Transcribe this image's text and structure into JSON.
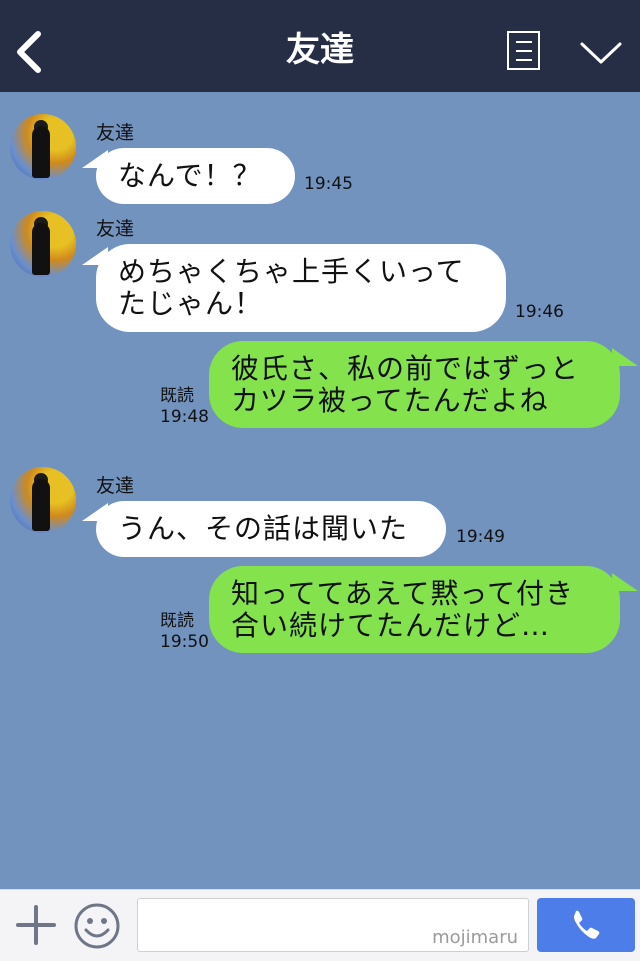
{
  "header": {
    "title": "友達",
    "icons": [
      "back-chevron-icon",
      "menu-list-icon",
      "chevron-down-icon"
    ]
  },
  "messages": [
    {
      "side": "in",
      "name": "友達",
      "text": "なんで！？",
      "time": "19:45"
    },
    {
      "side": "in",
      "name": "友達",
      "text": "めちゃくちゃ上手くいって\nたじゃん！",
      "time": "19:46"
    },
    {
      "side": "out",
      "read": "既読",
      "text": "彼氏さ、私の前ではずっと\nカツラ被ってたんだよね",
      "time": "19:48"
    },
    {
      "side": "in",
      "name": "友達",
      "text": "うん、その話は聞いた",
      "time": "19:49"
    },
    {
      "side": "out",
      "read": "既読",
      "text": "知っててあえて黙って付き\n合い続けてたんだけど…",
      "time": "19:50"
    }
  ],
  "footer": {
    "input_value": "",
    "watermark": "mojimaru",
    "icons": [
      "plus-icon",
      "smiley-icon",
      "phone-icon"
    ]
  },
  "colors": {
    "header_bg": "#262e45",
    "chat_bg": "#7393bf",
    "incoming_bubble": "#ffffff",
    "outgoing_bubble": "#84e24c",
    "call_button": "#4c7de8"
  }
}
